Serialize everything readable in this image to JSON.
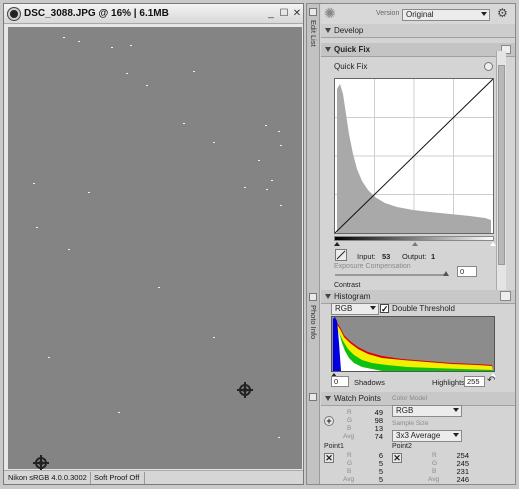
{
  "image_window": {
    "title": "DSC_3088.JPG @ 16% | 6.1MB",
    "controls": {
      "minimize": "_",
      "maximize": "☐",
      "close": "✕"
    },
    "status": {
      "profile": "Nikon sRGB 4.0.0.3002",
      "soft_proof": "Soft Proof Off"
    }
  },
  "palette": {
    "version_label": "Version",
    "version_value": "Original",
    "side_tabs": {
      "edit_list": "Edit List",
      "photo_info": "Photo Info"
    },
    "sections": {
      "develop": "Develop",
      "quick_fix": "Quick Fix"
    },
    "quick_fix_sub": "Quick Fix",
    "curves": {
      "input_label": "Input:",
      "input_value": "53",
      "output_label": "Output:",
      "output_value": "1"
    },
    "exposure_label": "Exposure Compensation",
    "exposure_value": "0",
    "contrast_label": "Contrast"
  },
  "histogram": {
    "title": "Histogram",
    "channel": "RGB",
    "double_threshold": "Double Threshold",
    "shadows_value": "0",
    "shadows_label": "Shadows",
    "highlights_label": "Highlights",
    "highlights_value": "255"
  },
  "watch_points": {
    "title": "Watch Points",
    "color_model_label": "Color Model",
    "color_model_value": "RGB",
    "sample_size_label": "Sample Size",
    "sample_size_value": "3x3 Average",
    "channel_labels": {
      "r": "R",
      "g": "G",
      "b": "B",
      "avg": "Avg"
    },
    "main": {
      "r": "49",
      "g": "98",
      "b": "13",
      "avg": "74"
    },
    "point1": {
      "label": "Point1",
      "r": "6",
      "g": "5",
      "b": "5",
      "avg": "5"
    },
    "point2": {
      "label": "Point2",
      "r": "254",
      "g": "245",
      "b": "231",
      "avg": "246"
    }
  },
  "colors": {
    "canvas_gray": "#848484",
    "panel_gray": "#d4d4d4",
    "hist_red": "#e00000",
    "hist_yellow": "#f0f000",
    "hist_blue": "#0000e0"
  }
}
